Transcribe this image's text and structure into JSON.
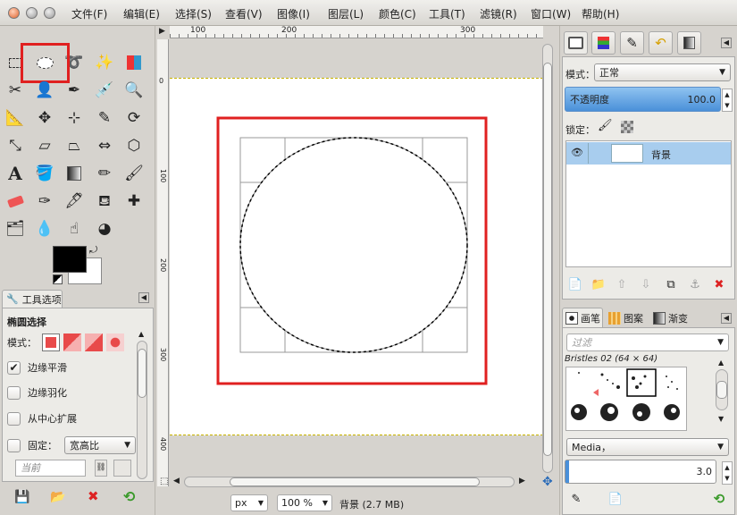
{
  "menubar": {
    "items": [
      "文件(F)",
      "编辑(E)",
      "选择(S)",
      "查看(V)",
      "图像(I)",
      "图层(L)",
      "颜色(C)",
      "工具(T)",
      "滤镜(R)",
      "窗口(W)",
      "帮助(H)"
    ]
  },
  "toolbox": {
    "options_tab_label": "工具选项",
    "tool_title": "椭圆选择",
    "mode_label": "模式：",
    "antialias_label": "边缘平滑",
    "feather_label": "边缘羽化",
    "expand_center_label": "从中心扩展",
    "fixed_label": "固定：",
    "fixed_value": "宽高比",
    "current_placeholder": "当前"
  },
  "ruler": {
    "h_ticks": [
      "100",
      "200",
      "300"
    ],
    "v_ticks": [
      "0",
      "100",
      "200",
      "300",
      "400"
    ]
  },
  "statusbar": {
    "unit": "px",
    "zoom": "100 %",
    "info": "背景 (2.7 MB)"
  },
  "layers": {
    "mode_label": "模式：",
    "mode_value": "正常",
    "opacity_label": "不透明度",
    "opacity_value": "100.0",
    "lock_label": "锁定：",
    "layer_name": "背景"
  },
  "brushes": {
    "tabs": [
      "画笔",
      "图案",
      "渐变"
    ],
    "filter_placeholder": "过滤",
    "brush_name": "Bristles 02 (64 × 64)",
    "preset": "Media，",
    "spacing_value": "3.0"
  },
  "colors": {
    "accent": "#4a90d9",
    "highlight": "#e02020",
    "fg": "#000000",
    "bg": "#ffffff",
    "selected_row": "#a8cdee"
  }
}
